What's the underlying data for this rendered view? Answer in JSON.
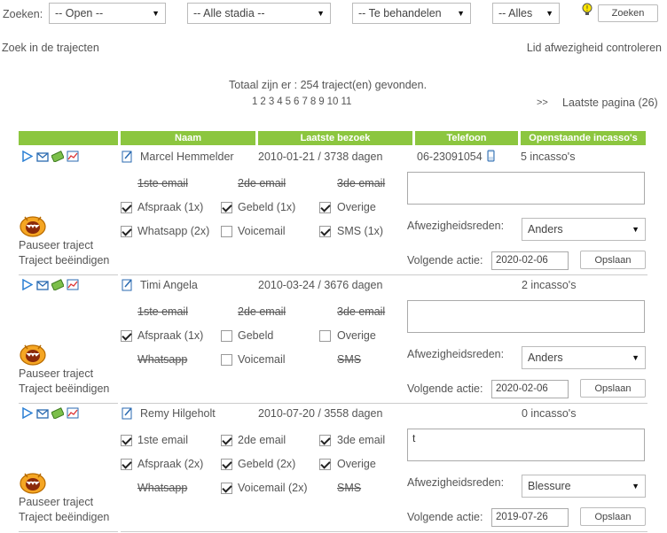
{
  "filters": {
    "label": "Zoeken:",
    "status": "-- Open --",
    "stadium": "-- Alle stadia --",
    "behandel": "-- Te behandelen",
    "alles": "-- Alles",
    "search_button": "Zoeken"
  },
  "links": {
    "left": "Zoek in de trajecten",
    "right": "Lid afwezigheid controleren"
  },
  "summary": "Totaal zijn er : 254 traject(en) gevonden.",
  "pagination": {
    "pages": [
      "1",
      "2",
      "3",
      "4",
      "5",
      "6",
      "7",
      "8",
      "9",
      "10",
      "11"
    ],
    "next": ">>",
    "last": "Laatste pagina (26)"
  },
  "table_headers": [
    "Naam",
    "Laatste bezoek",
    "Telefoon",
    "Openstaande incasso's"
  ],
  "common": {
    "pause": "Pauseer traject",
    "end": "Traject beëindigen",
    "reason_label": "Afwezigheidsreden:",
    "next_label": "Volgende actie:",
    "save": "Opslaan",
    "sep": "/"
  },
  "rows": [
    {
      "name": "Marcel Hemmelder",
      "date": "2010-01-21",
      "days": "3738 dagen",
      "phone": "06-23091054",
      "incasso": "5 incasso's",
      "actions": [
        [
          "1ste email",
          "2de email",
          "3de email"
        ],
        [
          "Afspraak (1x)",
          "Gebeld (1x)",
          "Overige"
        ],
        [
          "Whatsapp (2x)",
          "Voicemail",
          "SMS (1x)"
        ]
      ],
      "note": "",
      "reason": "Anders",
      "next_date": "2020-02-06"
    },
    {
      "name": "Timi Angela",
      "date": "2010-03-24",
      "days": "3676 dagen",
      "phone": "",
      "incasso": "2 incasso's",
      "actions": [
        [
          "1ste email",
          "2de email",
          "3de email"
        ],
        [
          "Afspraak (1x)",
          "Gebeld",
          "Overige"
        ],
        [
          "Whatsapp",
          "Voicemail",
          "SMS"
        ]
      ],
      "note": "",
      "reason": "Anders",
      "next_date": "2020-02-06"
    },
    {
      "name": "Remy Hilgeholt",
      "date": "2010-07-20",
      "days": "3558 dagen",
      "phone": "",
      "incasso": "0 incasso's",
      "actions": [
        [
          "1ste email",
          "2de email",
          "3de email"
        ],
        [
          "Afspraak (2x)",
          "Gebeld (2x)",
          "Overige"
        ],
        [
          "Whatsapp",
          "Voicemail (2x)",
          "SMS"
        ]
      ],
      "note": "t",
      "reason": "Blessure",
      "next_date": "2019-07-26"
    }
  ],
  "colors": {
    "header_green": "#8cc63f",
    "icon_blue": "#2a7fd4",
    "mascot_orange": "#f5a623"
  }
}
